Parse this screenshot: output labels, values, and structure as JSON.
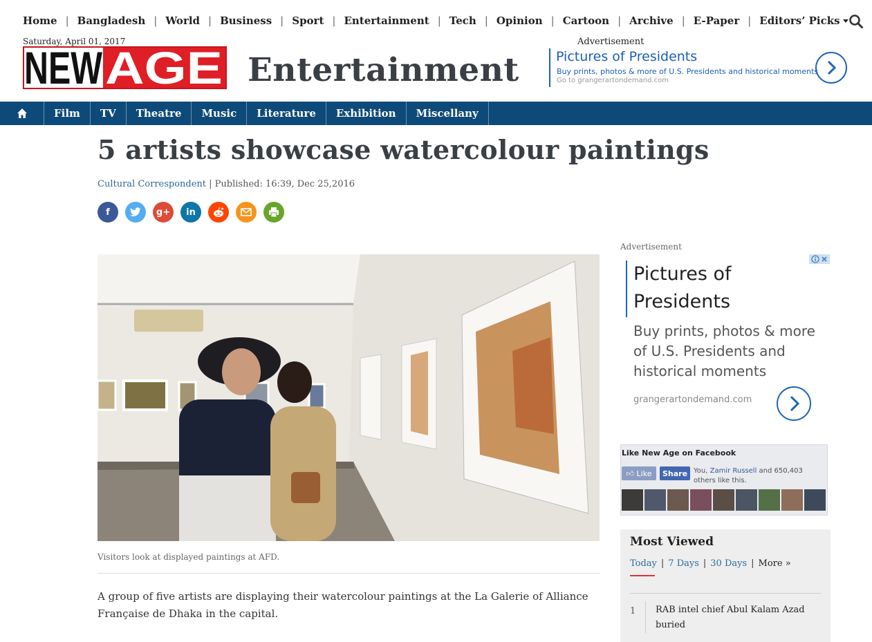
{
  "topnav": {
    "items": [
      "Home",
      "Bangladesh",
      "World",
      "Business",
      "Sport",
      "Entertainment",
      "Tech",
      "Opinion",
      "Cartoon",
      "Archive",
      "E-Paper",
      "Editors’ Picks"
    ]
  },
  "header": {
    "date": "Saturday, April 01, 2017",
    "logo_text": "NEWAGE",
    "section_title": "Entertainment"
  },
  "top_ad": {
    "label": "Advertisement",
    "title": "Pictures of Presidents",
    "desc": "Buy prints, photos & more of U.S. Presidents and historical moments",
    "url": "Go to grangerartondemand.com"
  },
  "section_nav": {
    "items": [
      "Film",
      "TV",
      "Theatre",
      "Music",
      "Literature",
      "Exhibition",
      "Miscellany"
    ]
  },
  "article": {
    "headline": "5 artists showcase watercolour paintings",
    "author": "Cultural Correspondent",
    "published": " | Published: 16:39, Dec 25,2016",
    "caption": "Visitors look at displayed paintings at AFD.",
    "paragraphs": [
      "A group of five artists are displaying their watercolour paintings at the La Galerie of Alliance Française de Dhaka in the capital."
    ]
  },
  "share": {
    "icons": [
      "facebook-icon",
      "twitter-icon",
      "google-plus-icon",
      "linkedin-icon",
      "reddit-icon",
      "email-icon",
      "print-icon"
    ],
    "colors": [
      "#3b5998",
      "#55acee",
      "#dd4b39",
      "#0e76a8",
      "#ff4500",
      "#f7941d",
      "#6aa52b"
    ],
    "glyphs": [
      "f",
      "t",
      "g+",
      "in",
      "r",
      "",
      "⎙"
    ]
  },
  "side_ad": {
    "label": "Advertisement",
    "title": "Pictures of Presidents",
    "desc": "Buy prints, photos & more of U.S. Presidents and historical moments",
    "url": "grangerartondemand.com"
  },
  "facebook": {
    "heading": "Like New Age on Facebook",
    "like": "Like",
    "share": "Share",
    "you": "You, ",
    "name": "Zamir Russell",
    "others": " and 650,403 others like this."
  },
  "most_viewed": {
    "heading": "Most Viewed",
    "tabs": [
      "Today",
      "7 Days",
      "30 Days",
      "More »"
    ],
    "items": [
      {
        "num": "1",
        "title": "RAB intel chief Abul Kalam Azad buried"
      }
    ]
  }
}
